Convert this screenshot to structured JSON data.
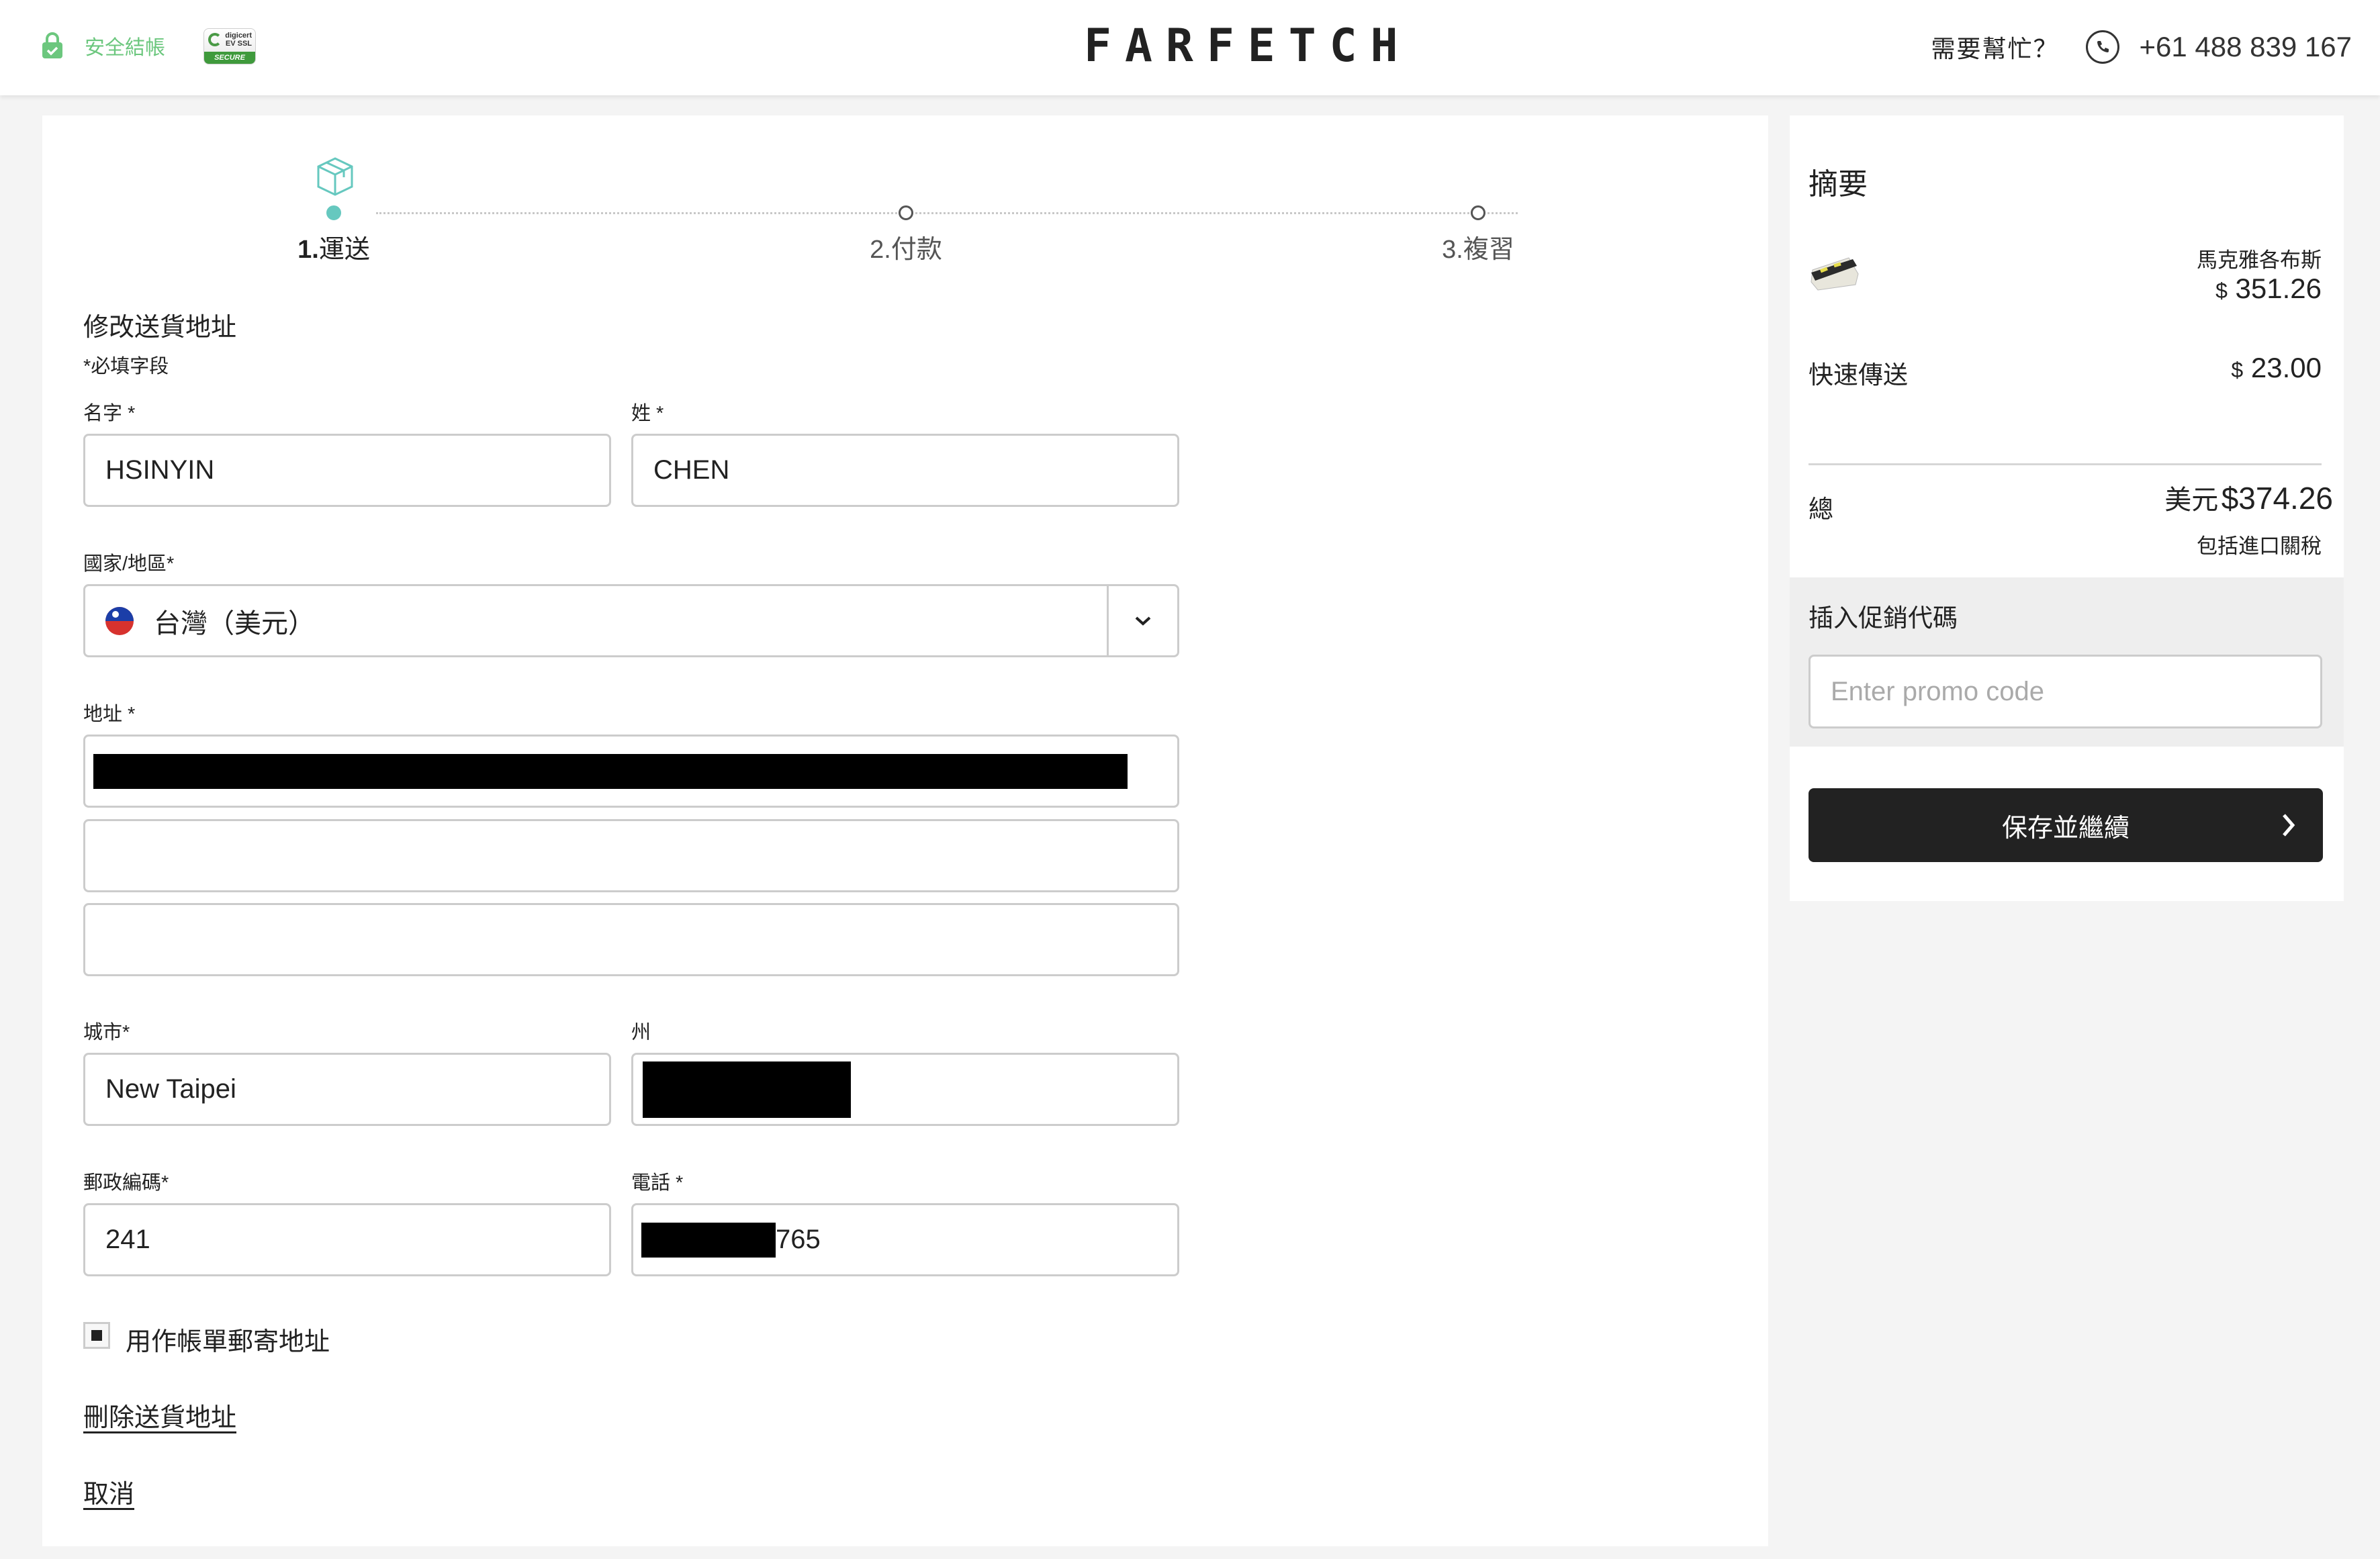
{
  "header": {
    "secure_checkout": "安全結帳",
    "ssl_badge": {
      "brand": "digicert",
      "type": "EV SSL",
      "status": "SECURE"
    },
    "logo": "FARFETCH",
    "help_text": "需要幫忙？",
    "phone": "+61 488 839 167",
    "icons": {
      "lock": "lock-check-icon",
      "phone": "phone-icon"
    }
  },
  "stepper": {
    "steps": [
      {
        "num": "1.",
        "label": "運送",
        "active": true
      },
      {
        "num": "2.",
        "label": "付款",
        "active": false
      },
      {
        "num": "3.",
        "label": "複習",
        "active": false
      }
    ],
    "icon": "package-box-icon"
  },
  "form": {
    "title": "修改送貨地址",
    "required_note": "*必填字段",
    "first_name": {
      "label": "名字 *",
      "value": "HSINYIN"
    },
    "last_name": {
      "label": "姓 *",
      "value": "CHEN"
    },
    "country": {
      "label": "國家/地區*",
      "value": "台灣（美元）",
      "flag": "taiwan-flag-icon"
    },
    "address": {
      "label": "地址 *",
      "line1": "[redacted]",
      "line2": "",
      "line3": ""
    },
    "city": {
      "label": "城市*",
      "value": "New Taipei"
    },
    "state": {
      "label": "州",
      "value": "[redacted]"
    },
    "postal_code": {
      "label": "郵政編碼*",
      "value": "241"
    },
    "phone": {
      "label": "電話 *",
      "value_suffix": "765"
    },
    "billing_checkbox": {
      "label": "用作帳單郵寄地址",
      "checked": true
    },
    "delete_link": "刪除送貨地址",
    "cancel_link": "取消"
  },
  "summary": {
    "title": "摘要",
    "item": {
      "brand": "馬克雅各布斯",
      "currency_symbol": "$",
      "price": "351.26"
    },
    "shipping": {
      "label": "快速傳送",
      "currency_symbol": "$",
      "price": "23.00"
    },
    "total": {
      "label": "總",
      "currency": "美元",
      "amount": "$374.26",
      "note": "包括進口關稅"
    },
    "promo": {
      "title": "插入促銷代碼",
      "placeholder": "Enter promo code",
      "value": ""
    },
    "continue_button": "保存並繼續"
  },
  "colors": {
    "accent": "#66c8bf",
    "secure_green": "#6cc77e",
    "button_dark": "#222222",
    "background": "#f4f4f4"
  }
}
